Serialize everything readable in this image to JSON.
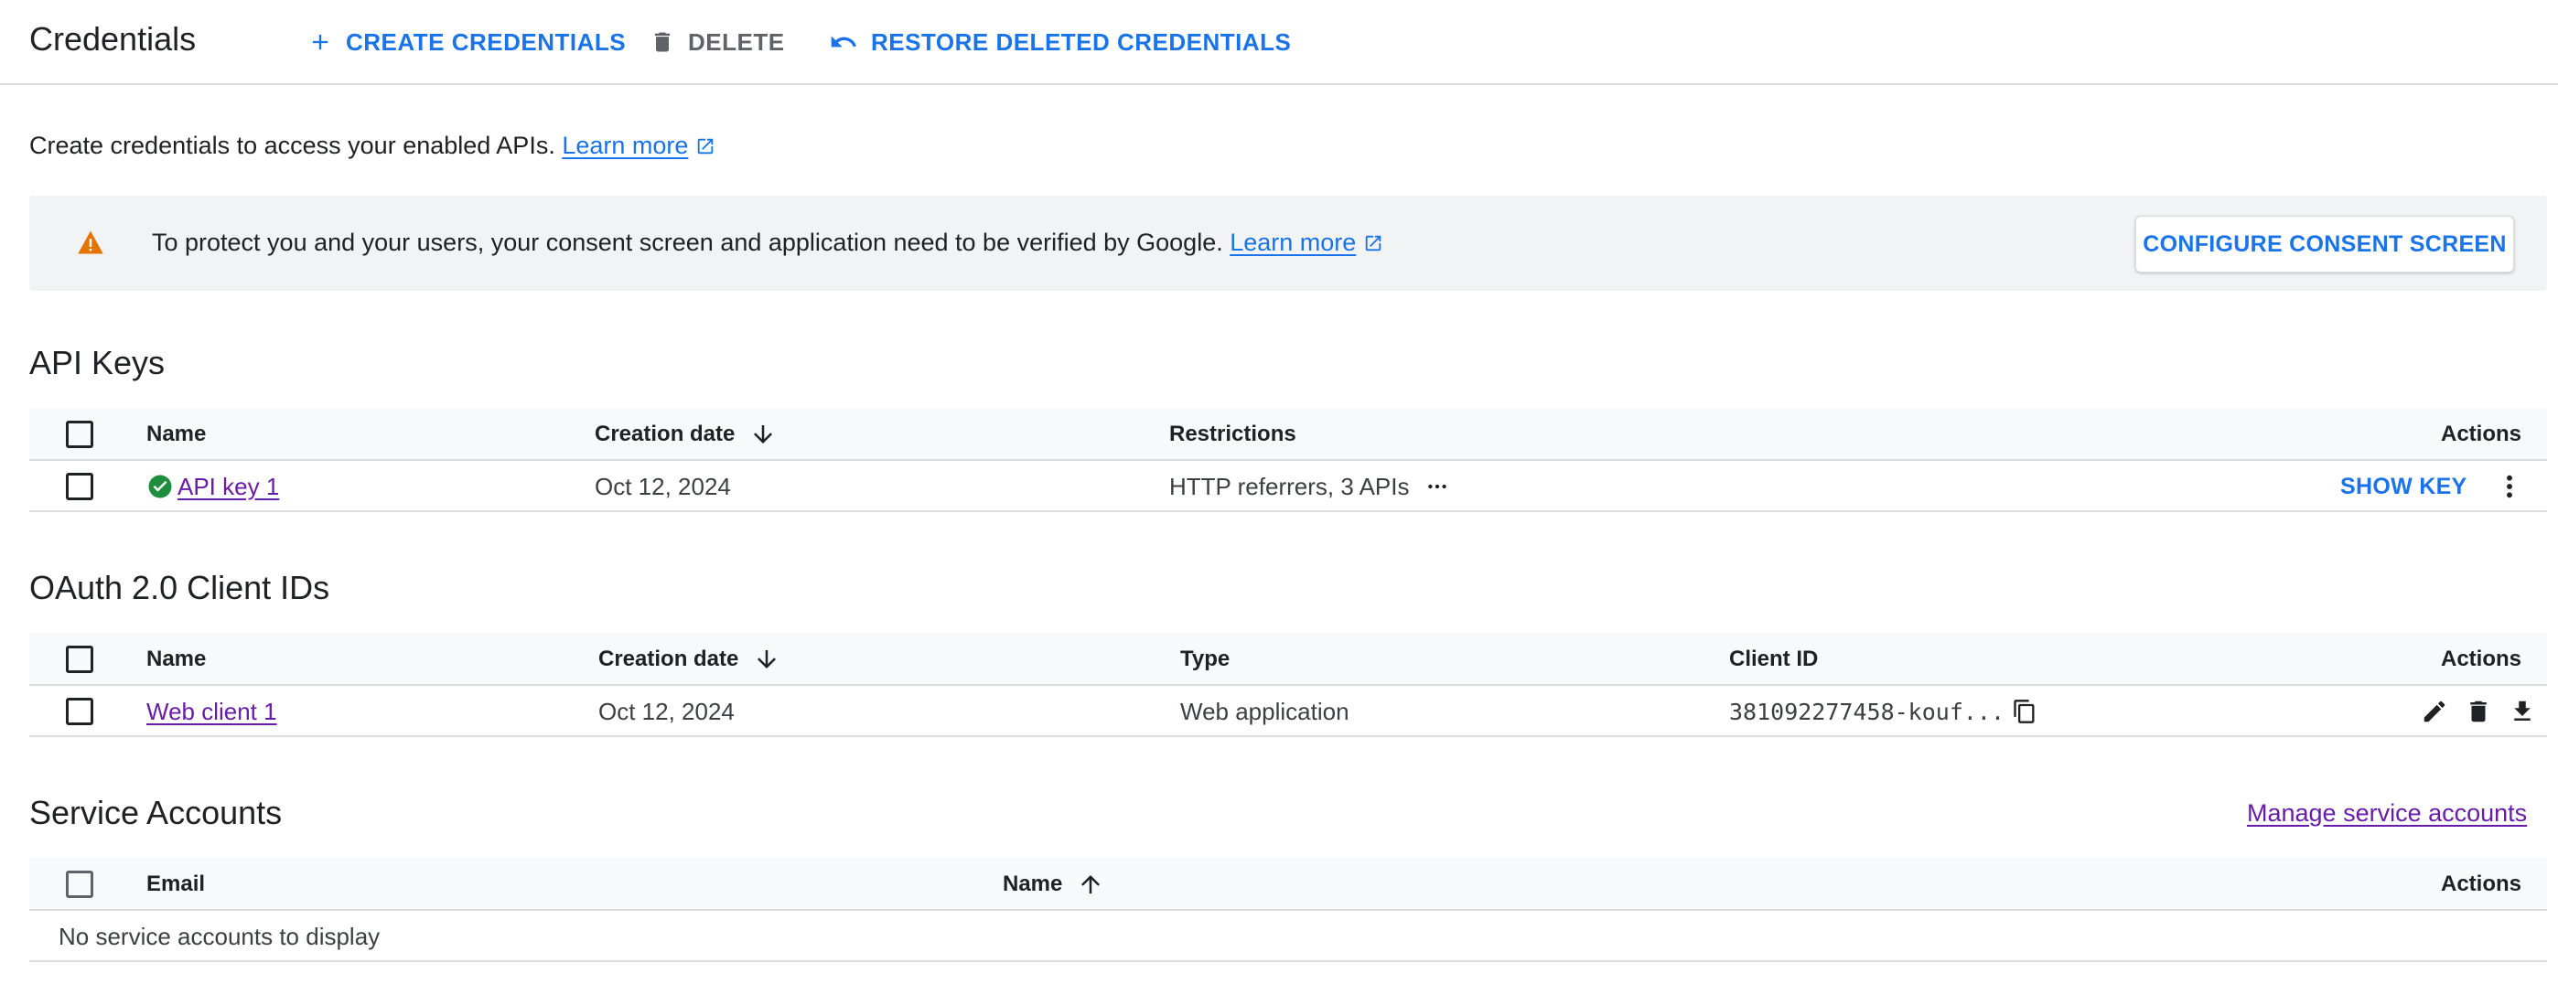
{
  "header": {
    "title": "Credentials",
    "create_label": "CREATE CREDENTIALS",
    "delete_label": "DELETE",
    "restore_label": "RESTORE DELETED CREDENTIALS"
  },
  "intro": {
    "text": "Create credentials to access your enabled APIs.",
    "learn_more": "Learn more"
  },
  "banner": {
    "text": "To protect you and your users, your consent screen and application need to be verified by Google.",
    "learn_more": "Learn more",
    "button_label": "CONFIGURE CONSENT SCREEN"
  },
  "api_keys": {
    "title": "API Keys",
    "columns": [
      "Name",
      "Creation date",
      "Restrictions",
      "Actions"
    ],
    "rows": [
      {
        "name": "API key 1",
        "created": "Oct 12, 2024",
        "restrictions": "HTTP referrers, 3 APIs",
        "show_key": "SHOW KEY"
      }
    ]
  },
  "oauth": {
    "title": "OAuth 2.0 Client IDs",
    "columns": [
      "Name",
      "Creation date",
      "Type",
      "Client ID",
      "Actions"
    ],
    "rows": [
      {
        "name": "Web client 1",
        "created": "Oct 12, 2024",
        "type": "Web application",
        "client_id": "381092277458-kouf..."
      }
    ]
  },
  "service_accounts": {
    "title": "Service Accounts",
    "manage_link": "Manage service accounts",
    "columns": [
      "Email",
      "Name",
      "Actions"
    ],
    "empty_text": "No service accounts to display"
  },
  "colors": {
    "accent": "#1a73e8",
    "visited_link": "#681da8",
    "warning": "#e37400",
    "success": "#1e8e3e"
  },
  "icons": [
    "plus-icon",
    "trash-icon",
    "undo-icon",
    "external-link-icon",
    "warning-icon",
    "arrow-down-icon",
    "arrow-up-icon",
    "check-circle-icon",
    "more-horiz-icon",
    "more-vert-icon",
    "copy-icon",
    "edit-icon",
    "download-icon"
  ]
}
